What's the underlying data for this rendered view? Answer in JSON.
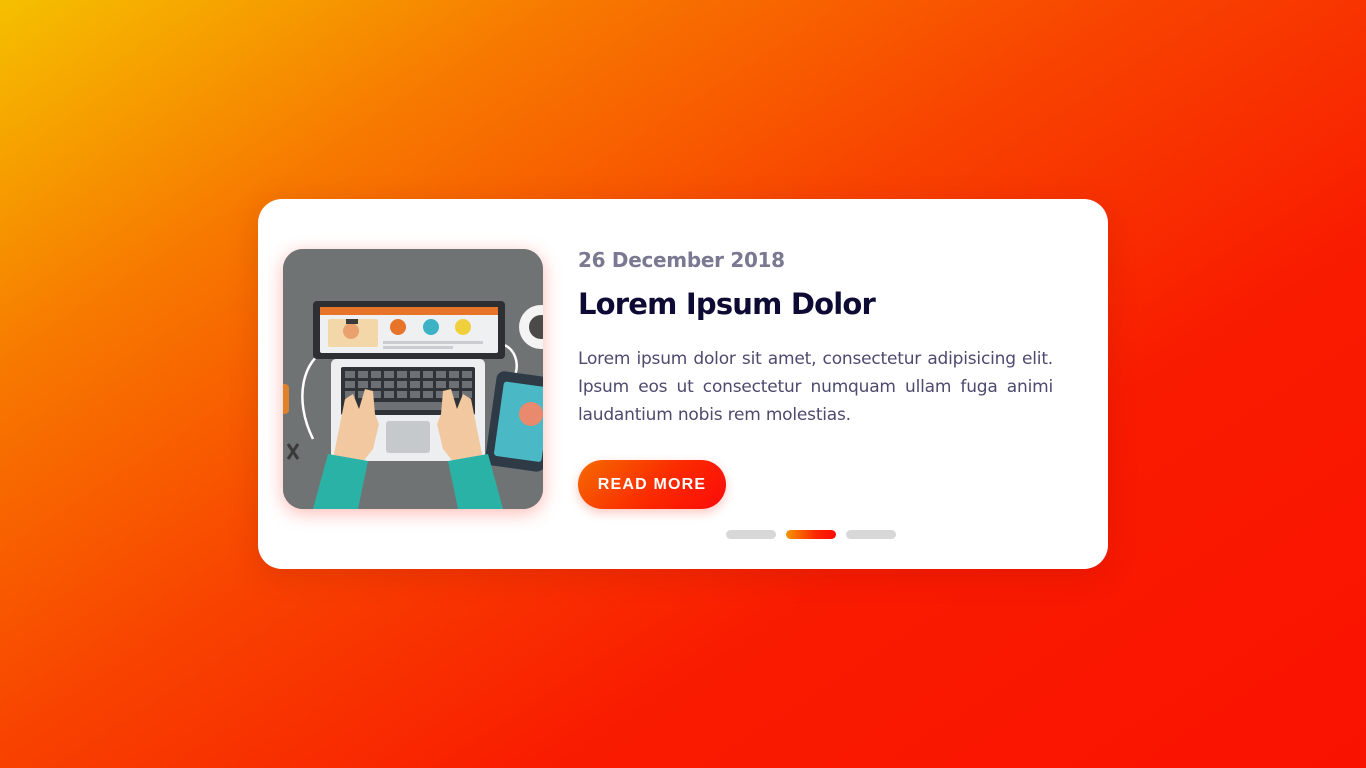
{
  "card": {
    "date": "26 December 2018",
    "title": "Lorem Ipsum Dolor",
    "description": "Lorem ipsum dolor sit amet, consectetur adipisicing elit. Ipsum eos ut consectetur numquam ullam fuga animi laudantium nobis rem molestias.",
    "button_label": "READ MORE",
    "image_icon": "laptop-workspace-illustration"
  },
  "slider": {
    "total_slides": 3,
    "active_index": 1
  },
  "colors": {
    "background_start": "#f5c000",
    "background_end": "#fa1200",
    "accent": "#fb2a00",
    "title": "#0d0a33",
    "date": "#7b7892",
    "text": "#4e4a6e",
    "dot_inactive": "#d8d8d8"
  }
}
